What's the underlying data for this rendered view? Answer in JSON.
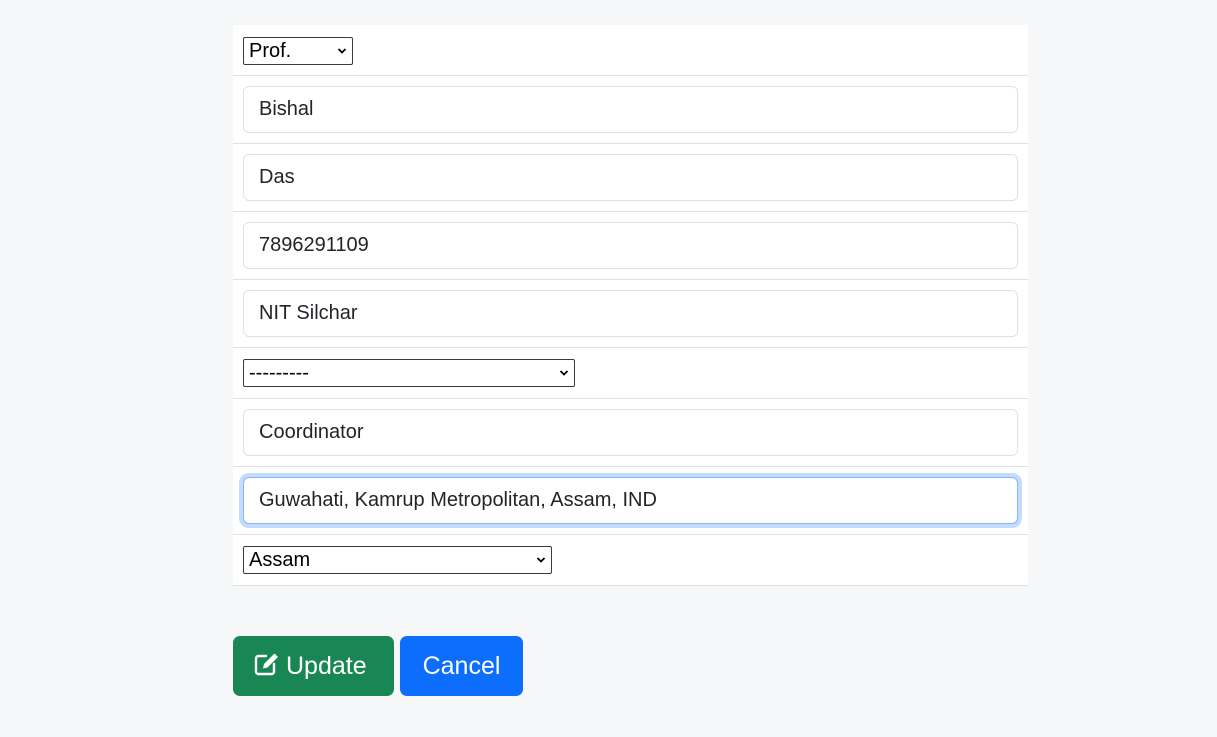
{
  "form": {
    "title_select": {
      "value": "Prof."
    },
    "first_name": {
      "value": "Bishal"
    },
    "last_name": {
      "value": "Das"
    },
    "phone": {
      "value": "7896291109"
    },
    "organization": {
      "value": "NIT Silchar"
    },
    "unspecified_select": {
      "value": "---------"
    },
    "designation": {
      "value": "Coordinator"
    },
    "location": {
      "value": "Guwahati, Kamrup Metropolitan, Assam, IND"
    },
    "state_select": {
      "value": "Assam"
    }
  },
  "actions": {
    "update_label": "Update",
    "update_icon": "edit-icon",
    "cancel_label": "Cancel"
  },
  "colors": {
    "update": "#198754",
    "cancel": "#0d6efd",
    "focus_border": "#86b7fe"
  }
}
